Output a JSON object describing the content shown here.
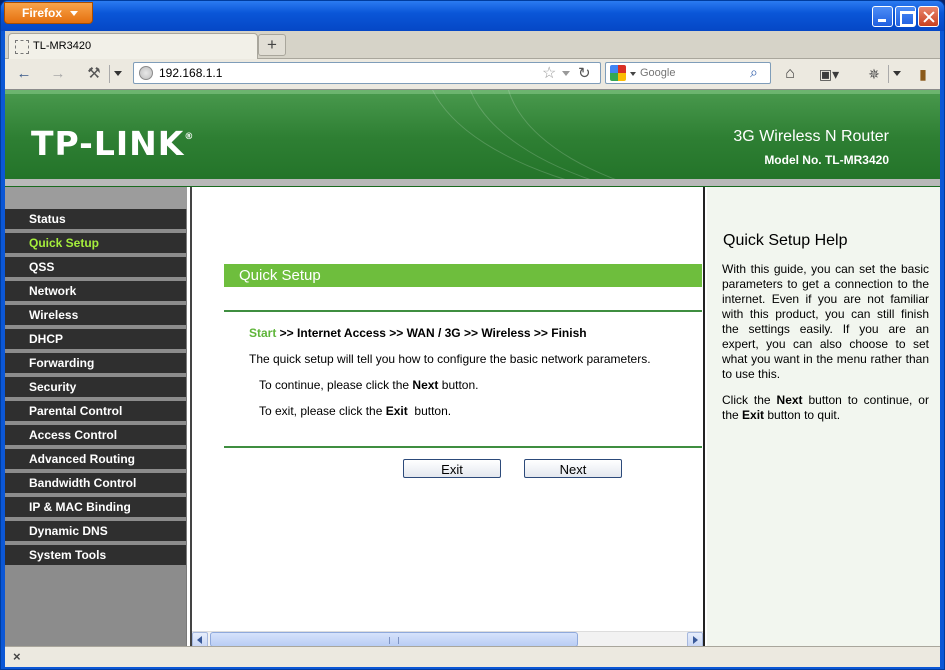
{
  "browser": {
    "app_menu_label": "Firefox",
    "tab_title": "TL-MR3420",
    "new_tab_label": "+",
    "url": "192.168.1.1",
    "search_placeholder": "Google",
    "icons": {
      "back": "back-arrow-icon",
      "forward": "forward-arrow-icon",
      "home": "home-icon",
      "reload": "reload-icon",
      "bookmark_star": "star-icon",
      "search": "magnifier-icon"
    },
    "status_close_label": "×"
  },
  "router": {
    "brand": "TP-LINK",
    "brand_mark": "®",
    "product": "3G Wireless N Router",
    "model": "Model No. TL-MR3420",
    "colors": {
      "banner_green": "#2e7f33",
      "menu_bg": "#2f2f2f",
      "menu_active": "#a5ee3c",
      "section_bar": "#6ebe3d"
    }
  },
  "sidebar": {
    "items": [
      {
        "label": "Status",
        "active": false
      },
      {
        "label": "Quick Setup",
        "active": true
      },
      {
        "label": "QSS",
        "active": false
      },
      {
        "label": "Network",
        "active": false
      },
      {
        "label": "Wireless",
        "active": false
      },
      {
        "label": "DHCP",
        "active": false
      },
      {
        "label": "Forwarding",
        "active": false
      },
      {
        "label": "Security",
        "active": false
      },
      {
        "label": "Parental Control",
        "active": false
      },
      {
        "label": "Access Control",
        "active": false
      },
      {
        "label": "Advanced Routing",
        "active": false
      },
      {
        "label": "Bandwidth Control",
        "active": false
      },
      {
        "label": "IP & MAC Binding",
        "active": false
      },
      {
        "label": "Dynamic DNS",
        "active": false
      },
      {
        "label": "System Tools",
        "active": false
      }
    ]
  },
  "main": {
    "title": "Quick Setup",
    "steps_first": "Start",
    "steps_rest": " >> Internet Access >> WAN / 3G >> Wireless >> Finish",
    "intro": "The quick setup will tell you how to configure the basic network parameters.",
    "continue_prefix": "To continue, please click the ",
    "continue_bold": "Next",
    "continue_suffix": " button.",
    "exit_prefix": "To exit, please click the ",
    "exit_bold": "Exit",
    "exit_suffix": "  button.",
    "exit_button": "Exit",
    "next_button": "Next"
  },
  "help": {
    "title": "Quick Setup Help",
    "p1": "With this guide, you can set the basic parameters to get a connection to the internet. Even if you are not familiar with this product, you can still finish the settings easily. If you are an expert, you can also choose to set what you want in the menu rather than to use this.",
    "p2_prefix": "Click the ",
    "p2_next": "Next",
    "p2_mid": " button to continue, or the ",
    "p2_exit": "Exit",
    "p2_suffix": " button to quit."
  }
}
